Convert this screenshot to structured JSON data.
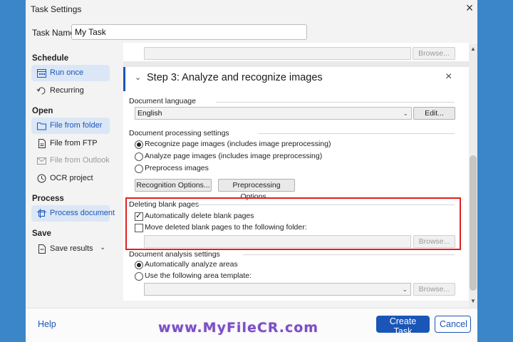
{
  "dialog": {
    "title": "Task Settings",
    "task_name_label": "Task Name:",
    "task_name_value": "My Task"
  },
  "sidebar": {
    "sections": [
      "Schedule",
      "Open",
      "Process",
      "Save"
    ],
    "items": [
      {
        "label": "Run once",
        "icon": "calendar-icon"
      },
      {
        "label": "Recurring",
        "icon": "recurring-icon"
      },
      {
        "label": "File from folder",
        "icon": "folder-icon"
      },
      {
        "label": "File from FTP",
        "icon": "ftp-icon"
      },
      {
        "label": "File from Outlook",
        "icon": "mail-icon"
      },
      {
        "label": "OCR project",
        "icon": "ocr-project-icon"
      },
      {
        "label": "Process document",
        "icon": "process-document-icon"
      },
      {
        "label": "Save results",
        "icon": "save-results-icon"
      }
    ]
  },
  "content": {
    "browse_label": "Browse...",
    "step_title": "Step 3: Analyze and recognize images",
    "doc_language_label": "Document language",
    "doc_language_value": "English",
    "edit_label": "Edit...",
    "doc_processing_label": "Document processing settings",
    "processing_options": [
      "Recognize page images (includes image preprocessing)",
      "Analyze page images (includes image preprocessing)",
      "Preprocess images"
    ],
    "recognition_options_label": "Recognition Options...",
    "preprocessing_options_label": "Preprocessing Options...",
    "blank_pages_label": "Deleting blank pages",
    "auto_delete_label": "Automatically delete blank pages",
    "move_deleted_label": "Move deleted blank pages to the following folder:",
    "doc_analysis_label": "Document analysis settings",
    "analysis_options": [
      "Automatically analyze areas",
      "Use the following area template:"
    ]
  },
  "footer": {
    "help_label": "Help",
    "create_label": "Create Task",
    "cancel_label": "Cancel",
    "watermark": "www.MyFileCR.com"
  },
  "colors": {
    "accent": "#1a56b8",
    "highlight_box": "#e02020",
    "background": "#3a86c8"
  }
}
